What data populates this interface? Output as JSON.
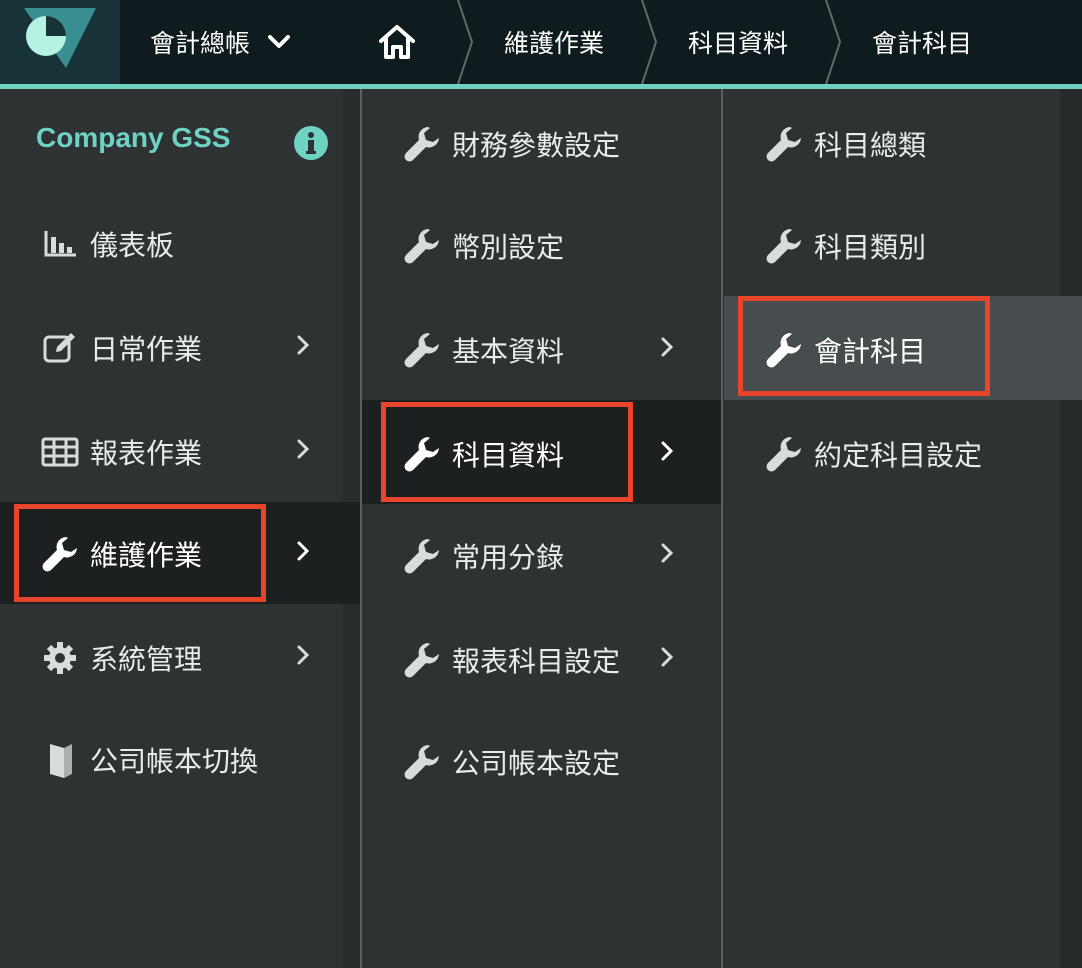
{
  "header": {
    "book_label": "會計總帳",
    "breadcrumbs": [
      "維護作業",
      "科目資料",
      "會計科目"
    ],
    "accent_color": "#6fd3c3"
  },
  "sidebar": {
    "company": "Company GSS",
    "items": [
      {
        "label": "儀表板",
        "icon": "bar-chart-icon",
        "has_submenu": false
      },
      {
        "label": "日常作業",
        "icon": "edit-icon",
        "has_submenu": true
      },
      {
        "label": "報表作業",
        "icon": "table-icon",
        "has_submenu": true
      },
      {
        "label": "維護作業",
        "icon": "wrench-icon",
        "has_submenu": true,
        "active": true
      },
      {
        "label": "系統管理",
        "icon": "gear-icon",
        "has_submenu": true
      },
      {
        "label": "公司帳本切換",
        "icon": "book-icon",
        "has_submenu": false
      }
    ]
  },
  "submenu": {
    "items": [
      {
        "label": "財務參數設定",
        "has_submenu": false
      },
      {
        "label": "幣別設定",
        "has_submenu": false
      },
      {
        "label": "基本資料",
        "has_submenu": true
      },
      {
        "label": "科目資料",
        "has_submenu": true,
        "active": true
      },
      {
        "label": "常用分錄",
        "has_submenu": true
      },
      {
        "label": "報表科目設定",
        "has_submenu": true
      },
      {
        "label": "公司帳本設定",
        "has_submenu": false
      }
    ]
  },
  "subsubmenu": {
    "items": [
      {
        "label": "科目總類",
        "active": false
      },
      {
        "label": "科目類別",
        "active": false
      },
      {
        "label": "會計科目",
        "active": true
      },
      {
        "label": "約定科目設定",
        "active": false
      }
    ]
  },
  "highlight_color": "#e8452c"
}
